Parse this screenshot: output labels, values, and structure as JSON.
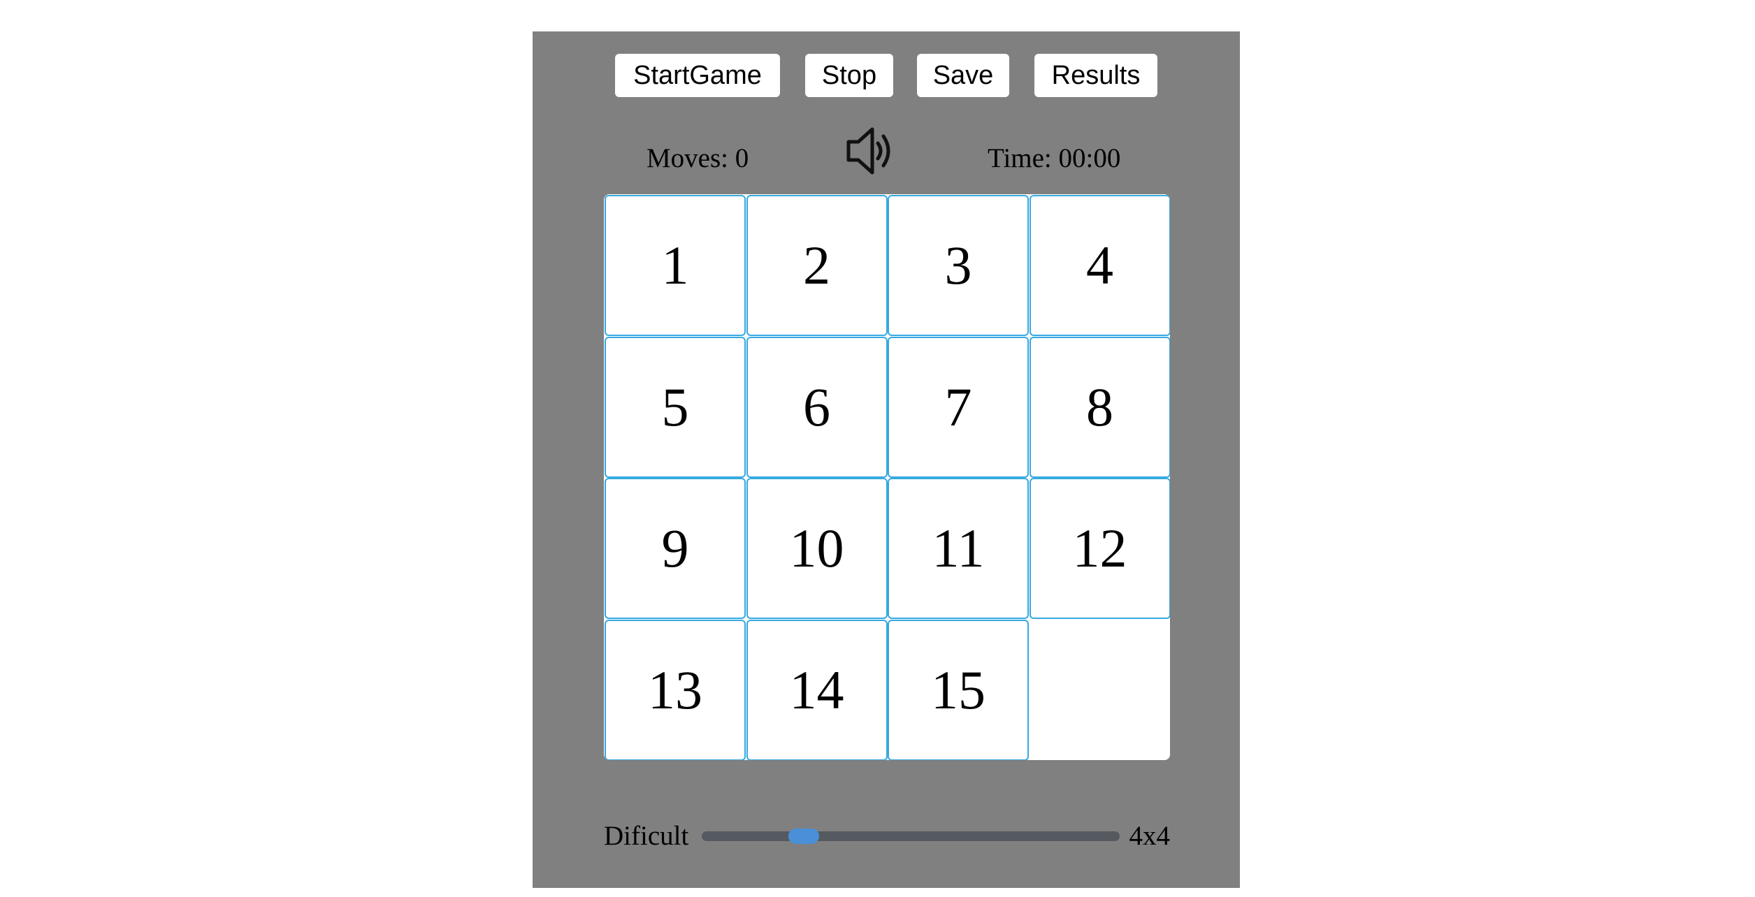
{
  "toolbar": {
    "start_label": "StartGame",
    "stop_label": "Stop",
    "save_label": "Save",
    "results_label": "Results"
  },
  "status": {
    "moves_text": "Moves: 0",
    "time_text": "Time: 00:00",
    "sound_icon": "speaker-on-icon"
  },
  "board": {
    "size": 4,
    "tiles": [
      "1",
      "2",
      "3",
      "4",
      "5",
      "6",
      "7",
      "8",
      "9",
      "10",
      "11",
      "12",
      "13",
      "14",
      "15",
      ""
    ],
    "tile_border_color": "#36a9e1",
    "background_color": "#808080"
  },
  "difficulty": {
    "label": "Dificult",
    "value_text": "4x4",
    "level_fraction": 0.17,
    "thumb_color": "#4a90d9"
  }
}
